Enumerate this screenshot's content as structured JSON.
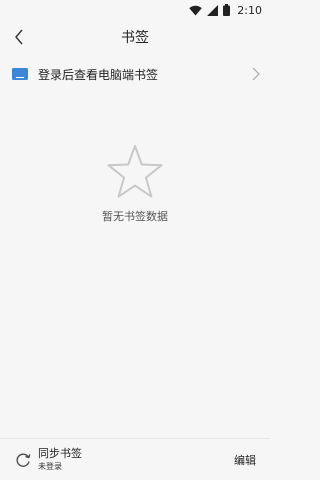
{
  "status_bar": {
    "time": "2:10"
  },
  "header": {
    "title": "书签"
  },
  "sync_prompt": {
    "label": "登录后查看电脑端书签"
  },
  "empty_state": {
    "message": "暂无书签数据"
  },
  "footer": {
    "sync_title": "同步书签",
    "sync_status": "未登录",
    "edit_label": "编辑"
  },
  "colors": {
    "accent": "#3d86d8",
    "muted_icon": "#c8c8c8",
    "background": "#f6f6f6"
  },
  "icons": [
    "wifi-icon",
    "signal-icon",
    "battery-icon",
    "back-arrow-icon",
    "computer-icon",
    "chevron-right-icon",
    "star-outline-icon",
    "sync-icon"
  ]
}
